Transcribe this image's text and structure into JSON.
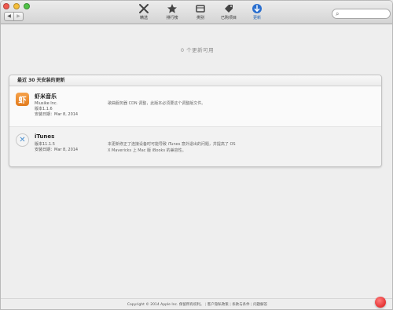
{
  "window": {
    "toolbar": {
      "nav": {
        "back": "◀",
        "forward": "▶"
      },
      "tabs": [
        {
          "label": "精选",
          "icon": "featured-icon",
          "active": false
        },
        {
          "label": "排行榜",
          "icon": "star-icon",
          "active": false
        },
        {
          "label": "类别",
          "icon": "categories-icon",
          "active": false
        },
        {
          "label": "已购项目",
          "icon": "purchased-icon",
          "active": false
        },
        {
          "label": "更新",
          "icon": "updates-icon",
          "active": true
        }
      ],
      "search": {
        "placeholder": ""
      }
    },
    "colors": {
      "accent": "#1a5fb4",
      "xiami_orange": "#e27a1c"
    }
  },
  "main": {
    "available_text": "0 个更新可用",
    "recent_header": "最近 30 天安装的更新",
    "items": [
      {
        "name": "虾米音乐",
        "icon": "xiami-app-icon",
        "developer": "Miusike Inc.",
        "version": "版本1.1.6",
        "installed": "安装日期：Mar 8, 2014",
        "description_lines": [
          "歌曲服务器 CDN 调整，此版本必须要这个调整版文件。"
        ]
      },
      {
        "name": "iTunes",
        "icon": "itunes-app-icon",
        "developer": "",
        "version": "版本11.1.5",
        "installed": "安装日期：Mar 8, 2014",
        "description_lines": [
          "本更新修正了连接设备时可能导致 iTunes 意外退出的问题，并提高了 OS",
          "X Mavericks 上 Mac 版 iBooks 的兼容性。"
        ]
      }
    ]
  },
  "footer": {
    "copyright": "Copyright © 2014 Apple Inc. 保留所有权利。",
    "links": [
      "客户隐私政策",
      "条款与条件",
      "问题解答"
    ]
  }
}
